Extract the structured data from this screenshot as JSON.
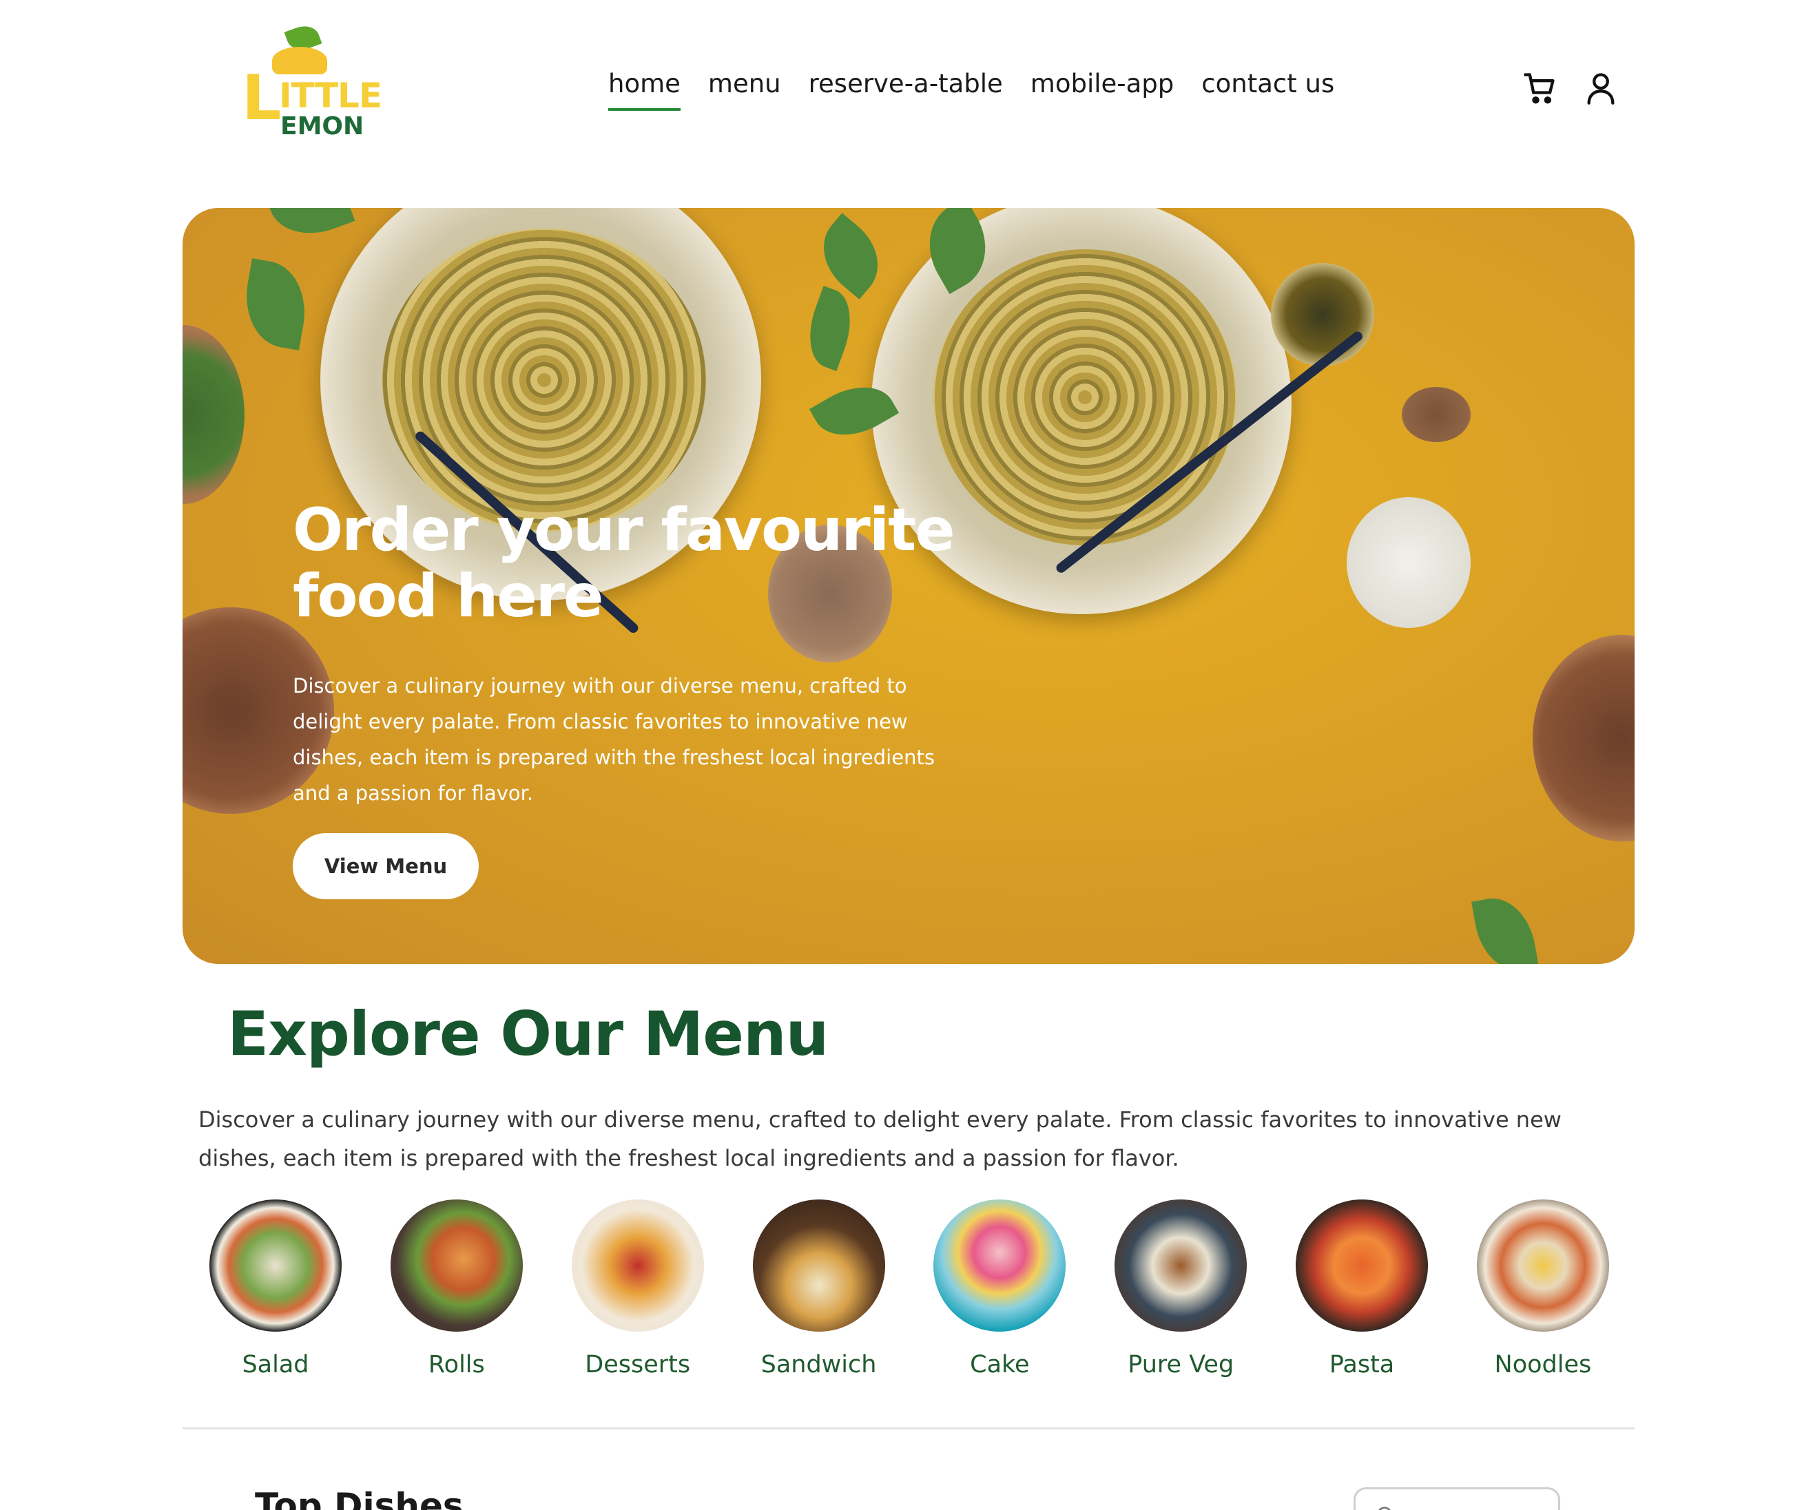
{
  "header": {
    "logo": {
      "big_letter": "L",
      "line1": "ITTLE",
      "line2": "EMON"
    },
    "nav": [
      {
        "label": "home",
        "active": true
      },
      {
        "label": "menu",
        "active": false
      },
      {
        "label": "reserve-a-table",
        "active": false
      },
      {
        "label": "mobile-app",
        "active": false
      },
      {
        "label": "contact us",
        "active": false
      }
    ],
    "icons": [
      "cart-icon",
      "user-icon"
    ]
  },
  "hero": {
    "title": "Order your favourite food here",
    "text": "Discover a culinary journey with our diverse menu, crafted to delight every palate. From classic favorites to innovative new dishes, each item is prepared with the freshest local ingredients and a passion for flavor.",
    "button": "View Menu"
  },
  "explore": {
    "title": "Explore Our Menu",
    "text": "Discover a culinary journey with our diverse menu, crafted to delight every palate. From classic favorites to innovative new dishes, each item is prepared with the freshest local ingredients and a passion for flavor.",
    "items": [
      {
        "label": "Salad"
      },
      {
        "label": "Rolls"
      },
      {
        "label": "Desserts"
      },
      {
        "label": "Sandwich"
      },
      {
        "label": "Cake"
      },
      {
        "label": "Pure Veg"
      },
      {
        "label": "Pasta"
      },
      {
        "label": "Noodles"
      }
    ]
  },
  "top_dishes": {
    "title": "Top Dishes"
  },
  "colors": {
    "accent_green": "#17552e",
    "nav_underline": "#2a8a3a",
    "hero_bg": "#daa025",
    "logo_yellow": "#f5cf35"
  }
}
